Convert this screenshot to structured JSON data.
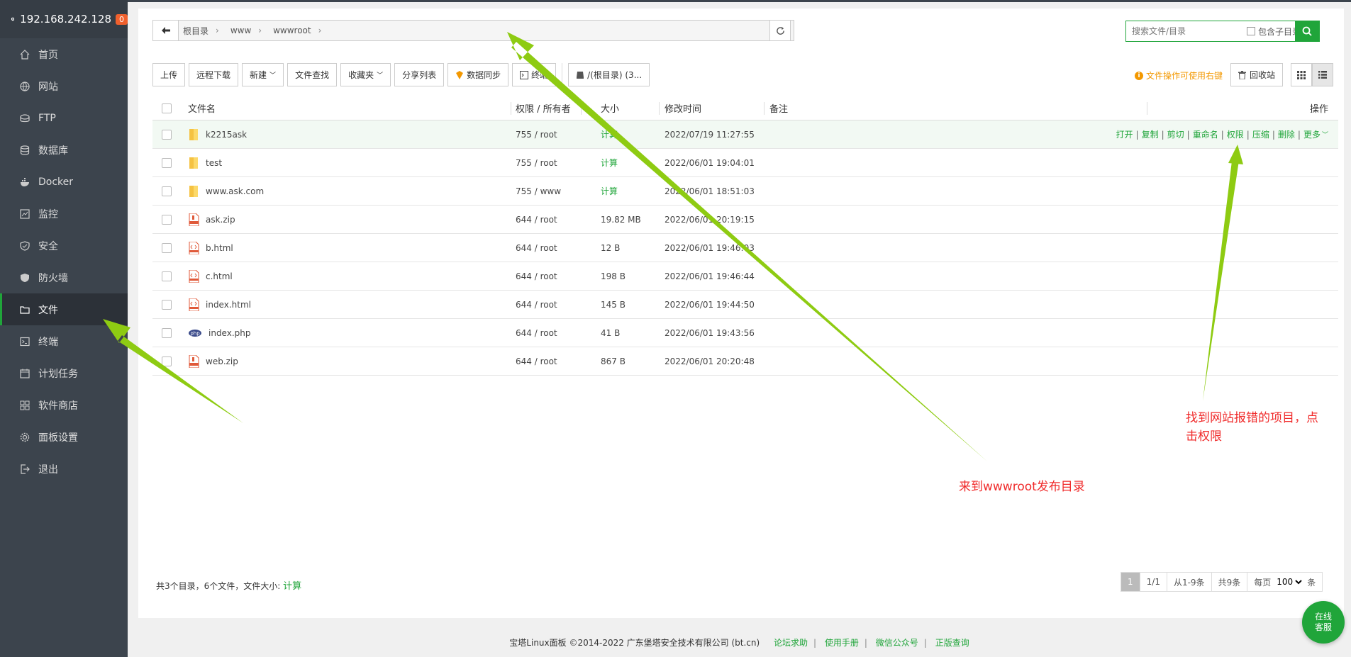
{
  "sidebar": {
    "host": "192.168.242.128",
    "badge": "0",
    "items": [
      {
        "label": "首页",
        "icon": "home-icon"
      },
      {
        "label": "网站",
        "icon": "globe-icon"
      },
      {
        "label": "FTP",
        "icon": "ftp-icon"
      },
      {
        "label": "数据库",
        "icon": "database-icon"
      },
      {
        "label": "Docker",
        "icon": "docker-icon"
      },
      {
        "label": "监控",
        "icon": "monitor-icon"
      },
      {
        "label": "安全",
        "icon": "shield-check-icon"
      },
      {
        "label": "防火墙",
        "icon": "firewall-icon"
      },
      {
        "label": "文件",
        "icon": "folder-icon",
        "active": true
      },
      {
        "label": "终端",
        "icon": "terminal-icon"
      },
      {
        "label": "计划任务",
        "icon": "calendar-icon"
      },
      {
        "label": "软件商店",
        "icon": "grid-icon"
      },
      {
        "label": "面板设置",
        "icon": "gear-icon"
      },
      {
        "label": "退出",
        "icon": "logout-icon"
      }
    ]
  },
  "path": {
    "crumbs": [
      "根目录",
      "www",
      "wwwroot"
    ]
  },
  "search": {
    "placeholder": "搜索文件/目录",
    "subdir_label": "包含子目录"
  },
  "toolbar": {
    "upload": "上传",
    "remote_download": "远程下载",
    "new": "新建",
    "file_search": "文件查找",
    "favorites": "收藏夹",
    "share_list": "分享列表",
    "data_sync": "数据同步",
    "terminal": "终端",
    "disk": "/(根目录) (3..."
  },
  "hint": "文件操作可使用右键",
  "recycle": "回收站",
  "table": {
    "headers": {
      "name": "文件名",
      "perm": "权限 / 所有者",
      "size": "大小",
      "mtime": "修改时间",
      "note": "备注",
      "ops": "操作"
    },
    "rows": [
      {
        "name": "k2215ask",
        "type": "folder",
        "perm": "755 / root",
        "size": "计算",
        "mtime": "2022/07/19 11:27:55"
      },
      {
        "name": "test",
        "type": "folder",
        "perm": "755 / root",
        "size": "计算",
        "mtime": "2022/06/01 19:04:01"
      },
      {
        "name": "www.ask.com",
        "type": "folder",
        "perm": "755 / www",
        "size": "计算",
        "mtime": "2022/06/01 18:51:03"
      },
      {
        "name": "ask.zip",
        "type": "zip",
        "perm": "644 / root",
        "size": "19.82 MB",
        "mtime": "2022/06/01 20:19:15"
      },
      {
        "name": "b.html",
        "type": "html",
        "perm": "644 / root",
        "size": "12 B",
        "mtime": "2022/06/01 19:46:03"
      },
      {
        "name": "c.html",
        "type": "html",
        "perm": "644 / root",
        "size": "198 B",
        "mtime": "2022/06/01 19:46:44"
      },
      {
        "name": "index.html",
        "type": "html",
        "perm": "644 / root",
        "size": "145 B",
        "mtime": "2022/06/01 19:44:50"
      },
      {
        "name": "index.php",
        "type": "php",
        "perm": "644 / root",
        "size": "41 B",
        "mtime": "2022/06/01 19:43:56"
      },
      {
        "name": "web.zip",
        "type": "zip",
        "perm": "644 / root",
        "size": "867 B",
        "mtime": "2022/06/01 20:20:48"
      }
    ],
    "row_ops": [
      "打开",
      "复制",
      "剪切",
      "重命名",
      "权限",
      "压缩",
      "删除",
      "更多"
    ]
  },
  "summary": {
    "text": "共3个目录，6个文件，文件大小:",
    "calc": "计算"
  },
  "pager": {
    "current": "1",
    "pages": "1/1",
    "range": "从1-9条",
    "total": "共9条",
    "per_page_label": "每页",
    "per_page": "100",
    "unit": "条"
  },
  "footer": {
    "copyright": "宝塔Linux面板 ©2014-2022 广东堡塔安全技术有限公司 (bt.cn)",
    "links": [
      "论坛求助",
      "使用手册",
      "微信公众号",
      "正版查询"
    ]
  },
  "chat": "在线客服",
  "annotations": {
    "note1": "来到wwwroot发布目录",
    "note2_line1": "找到网站报错的项目，点",
    "note2_line2": "击权限",
    "arrow_color": "#8ecb12",
    "text_color": "#f02a2a"
  }
}
